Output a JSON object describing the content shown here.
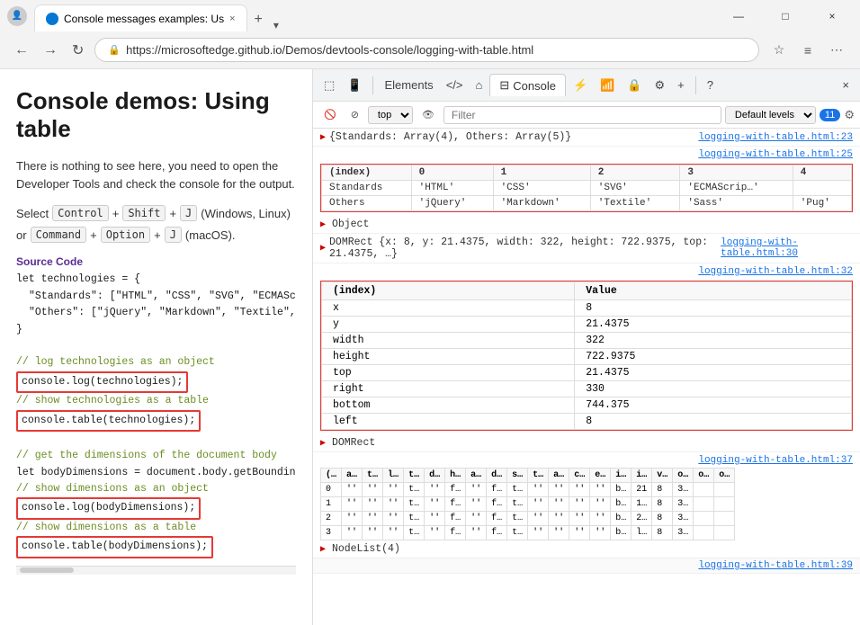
{
  "browser": {
    "title": "Console messages examples: Us",
    "url": "https://microsoftedge.github.io/Demos/devtools-console/logging-with-table.html",
    "tab_close": "×",
    "tab_add": "+",
    "nav_back": "←",
    "nav_forward": "→",
    "nav_refresh": "↻",
    "win_minimize": "—",
    "win_maximize": "□",
    "win_close": "×"
  },
  "left_panel": {
    "title": "Console demos: Using table",
    "description": "There is nothing to see here, you need to open the Developer Tools and check the console for the output.",
    "shortcut1_prefix": "Select",
    "shortcut1_key1": "Control",
    "shortcut1_plus1": "+",
    "shortcut1_key2": "Shift",
    "shortcut1_plus2": "+",
    "shortcut1_key3": "J",
    "shortcut1_suffix": "(Windows, Linux)",
    "shortcut2_or": "or",
    "shortcut2_key1": "Command",
    "shortcut2_plus": "+",
    "shortcut2_key2": "Option",
    "shortcut2_plus2": "+",
    "shortcut2_key3": "J",
    "shortcut2_suffix": "(macOS).",
    "source_label": "Source Code",
    "code_lines": [
      "let technologies = {",
      "  \"Standards\": [\"HTML\", \"CSS\", \"SVG\", \"ECMASc",
      "  \"Others\": [\"jQuery\", \"Markdown\", \"Textile\",",
      "}",
      "",
      "// log technologies as an object"
    ],
    "code_highlight1": "console.log(technologies);",
    "code_comment2": "// show technologies as a table",
    "code_highlight2": "console.table(technologies);",
    "code_comment3": "",
    "code_line_comment3": "// get the dimensions of the document body",
    "code_line4": "let bodyDimensions = document.body.getBoundin",
    "code_comment4": "// show dimensions as an object",
    "code_highlight3": "console.log(bodyDimensions);",
    "code_comment5": "// show dimensions as a table",
    "code_highlight4": "console.table(bodyDimensions);"
  },
  "devtools": {
    "toolbar_buttons": [
      "panel-icon",
      "panel2-icon",
      "mobile-icon",
      "element-icon",
      "source-icon"
    ],
    "console_tab": "Console",
    "filter_top": "top",
    "filter_eye": "👁",
    "filter_placeholder": "Filter",
    "filter_level": "Default levels",
    "badge_count": "11",
    "console_entries": [
      {
        "id": "entry1",
        "link": "logging-with-table.html:23",
        "text": "{Standards: Array(4), Others: Array(5)}",
        "has_expand": true
      },
      {
        "id": "entry2",
        "link": "logging-with-table.html:25",
        "has_table": true,
        "table_headers": [
          "(index)",
          "0",
          "1",
          "2",
          "3",
          "4"
        ],
        "table_rows": [
          [
            "Standards",
            "'HTML'",
            "'CSS'",
            "'SVG'",
            "'ECMAScrip…'",
            ""
          ],
          [
            "Others",
            "'jQuery'",
            "'Markdown'",
            "'Textile'",
            "'Sass'",
            "'Pug'"
          ]
        ],
        "has_object_row": true,
        "object_label": "▶ Object"
      },
      {
        "id": "entry3",
        "link": "logging-with-table.html:30",
        "text": "▶ DOMRect {x: 8, y: 21.4375, width: 322, height: 722.9375, top: 21.4375, …}",
        "has_expand": true
      },
      {
        "id": "entry4",
        "link": "logging-with-table.html:32",
        "has_value_table": true,
        "table_headers2": [
          "(index)",
          "Value"
        ],
        "table_rows2": [
          [
            "x",
            "8"
          ],
          [
            "y",
            "21.4375"
          ],
          [
            "width",
            "322"
          ],
          [
            "height",
            "722.9375"
          ],
          [
            "top",
            "21.4375"
          ],
          [
            "right",
            "330"
          ],
          [
            "bottom",
            "744.375"
          ],
          [
            "left",
            "8"
          ]
        ],
        "object_label2": "▶ DOMRect"
      },
      {
        "id": "entry5",
        "link": "logging-with-table.html:37",
        "has_nodelist": true,
        "nodelist_headers": [
          "(…",
          "a…",
          "t…",
          "l…",
          "t…",
          "d…",
          "h…",
          "a…",
          "d…",
          "s…",
          "t…",
          "a…",
          "c…",
          "e…",
          "i…",
          "i…",
          "v…",
          "o…",
          "o…",
          "o…"
        ],
        "nodelist_rows": [
          [
            "0",
            "''",
            "''",
            "''",
            "t…",
            "''",
            "f…",
            "''",
            "f…",
            "t…",
            "''",
            "''",
            "''",
            "''",
            "b…",
            "21",
            "8",
            "3…"
          ],
          [
            "1",
            "''",
            "''",
            "''",
            "t…",
            "''",
            "f…",
            "''",
            "f…",
            "t…",
            "''",
            "''",
            "''",
            "''",
            "b…",
            "1…",
            "8",
            "3…"
          ],
          [
            "2",
            "''",
            "''",
            "''",
            "t…",
            "''",
            "f…",
            "''",
            "f…",
            "t…",
            "''",
            "''",
            "''",
            "''",
            "b…",
            "2…",
            "8",
            "3…"
          ],
          [
            "3",
            "''",
            "''",
            "''",
            "t…",
            "''",
            "f…",
            "''",
            "f…",
            "t…",
            "''",
            "''",
            "''",
            "''",
            "b…",
            "l…",
            "8",
            "3…"
          ]
        ],
        "nodelist_label": "▶ NodeList(4)"
      }
    ],
    "bottom_link": "logging-with-table.html:39"
  }
}
